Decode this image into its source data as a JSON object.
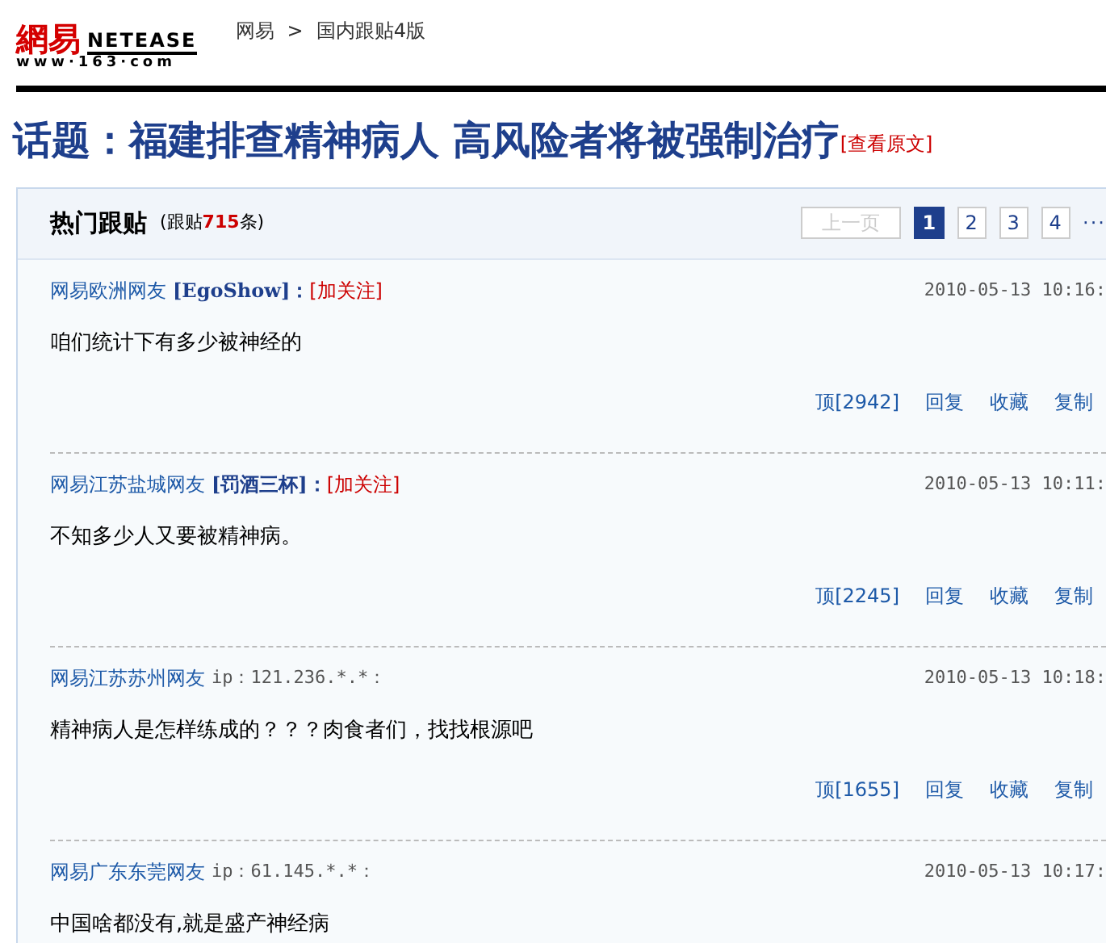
{
  "logo": {
    "mark": "網易",
    "brand": "NETEASE",
    "domain": "www·163·com"
  },
  "breadcrumb": [
    {
      "label": "网易"
    },
    {
      "label": "国内跟贴4版"
    }
  ],
  "breadcrumb_separator": ">",
  "title": "话题：福建排查精神病人 高风险者将被强制治疗",
  "source_link": "[查看原文]",
  "panel": {
    "heading": "热门跟贴",
    "count_prefix": "(跟贴",
    "count": "715",
    "count_suffix": "条)"
  },
  "pagination": {
    "prev": {
      "label": "上一页",
      "disabled": true
    },
    "pages": [
      {
        "label": "1",
        "selected": true
      },
      {
        "label": "2",
        "selected": false
      },
      {
        "label": "3",
        "selected": false
      },
      {
        "label": "4",
        "selected": false
      }
    ],
    "ellipsis": "···"
  },
  "comments": [
    {
      "kind": "follow",
      "user": "网易欧洲网友",
      "handle": "[EgoShow]",
      "colon": "：",
      "follow": "[加关注]",
      "time": "2010-05-13 10:16:",
      "text": "咱们统计下有多少被神经的",
      "actions": [
        "顶[2942]",
        "回复",
        "收藏",
        "复制"
      ]
    },
    {
      "kind": "follow",
      "user": "网易江苏盐城网友",
      "handle": "[罚酒三杯]",
      "colon": "：",
      "follow": "[加关注]",
      "time": "2010-05-13 10:11:",
      "text": "不知多少人又要被精神病。",
      "actions": [
        "顶[2245]",
        "回复",
        "收藏",
        "复制"
      ]
    },
    {
      "kind": "ip",
      "user": "网易江苏苏州网友",
      "ip": "ip：121.236.*.*：",
      "time": "2010-05-13 10:18:",
      "text": "精神病人是怎样练成的？？？肉食者们，找找根源吧",
      "actions": [
        "顶[1655]",
        "回复",
        "收藏",
        "复制"
      ]
    },
    {
      "kind": "ip",
      "user": "网易广东东莞网友",
      "ip": "ip：61.145.*.*：",
      "time": "2010-05-13 10:17:",
      "text": "中国啥都没有,就是盛产神经病"
    }
  ]
}
